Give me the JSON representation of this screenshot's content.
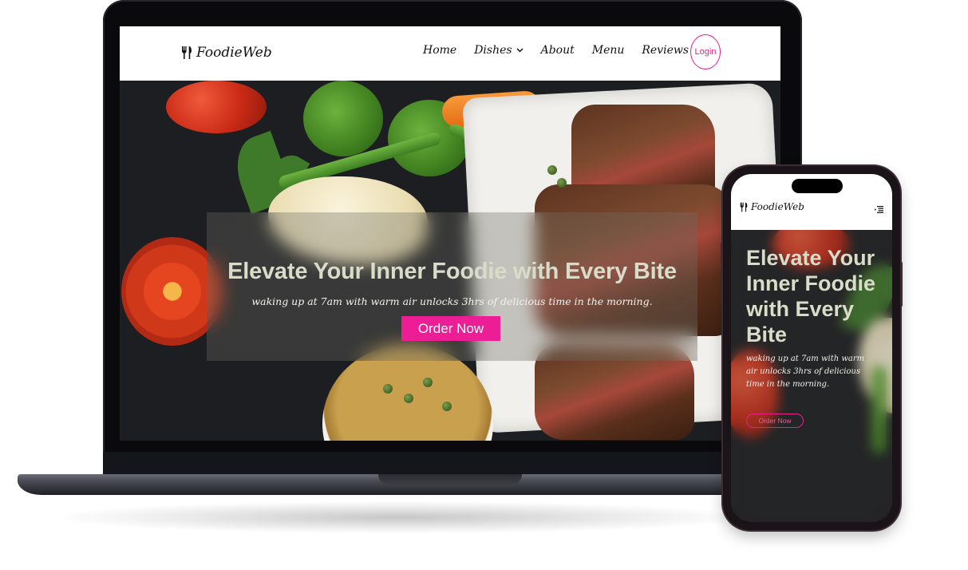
{
  "brand": {
    "name": "FoodieWeb"
  },
  "nav": {
    "items": [
      {
        "label": "Home",
        "has_dropdown": false
      },
      {
        "label": "Dishes",
        "has_dropdown": true
      },
      {
        "label": "About",
        "has_dropdown": false
      },
      {
        "label": "Menu",
        "has_dropdown": false
      },
      {
        "label": "Reviews",
        "has_dropdown": false
      }
    ],
    "login_label": "Login"
  },
  "hero": {
    "title": "Elevate Your Inner Foodie with Every Bite",
    "subtitle": "waking up at 7am with warm air unlocks 3hrs of delicious time in the morning.",
    "cta_label": "Order Now"
  },
  "mobile": {
    "title": "Elevate Your Inner Foodie with Every Bite",
    "subtitle": "waking up at 7am with warm air unlocks 3hrs of delicious time in the morning.",
    "cta_label": "Order Now",
    "menu_icon": "menu-icon"
  },
  "colors": {
    "accent": "#ec1d95",
    "header_bg": "#ffffff",
    "hero_title": "#d9dcc9"
  },
  "icons": {
    "logo": "fork-knife-icon",
    "dropdown": "chevron-down-icon"
  }
}
